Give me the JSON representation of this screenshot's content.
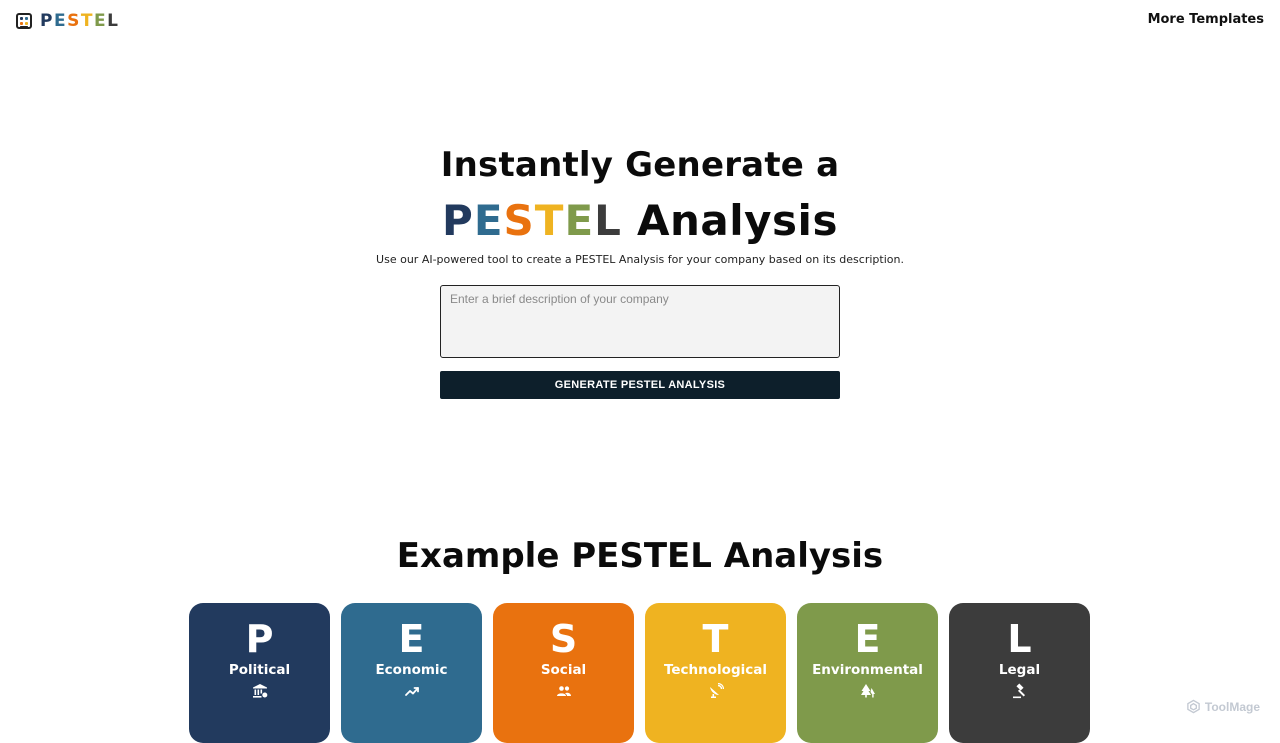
{
  "header": {
    "brand_letters": [
      {
        "char": "P",
        "color": "#223a5e"
      },
      {
        "char": "E",
        "color": "#2f6b8f"
      },
      {
        "char": "S",
        "color": "#e9720f"
      },
      {
        "char": "T",
        "color": "#efb321"
      },
      {
        "char": "E",
        "color": "#7f9a4b"
      },
      {
        "char": "L",
        "color": "#3c3c3c"
      }
    ],
    "more_templates_label": "More Templates"
  },
  "hero": {
    "line1": "Instantly Generate a",
    "line2_suffix": "Analysis",
    "subtitle": "Use our AI-powered tool to create a PESTEL Analysis for your company based on its description.",
    "input_placeholder": "Enter a brief description of your company",
    "input_value": "",
    "generate_label": "GENERATE PESTEL ANALYSIS"
  },
  "example": {
    "title": "Example PESTEL Analysis",
    "cards": [
      {
        "letter": "P",
        "name": "Political",
        "icon": "government-building-icon",
        "color": "#223a5e",
        "text": ""
      },
      {
        "letter": "E",
        "name": "Economic",
        "icon": "trending-up-icon",
        "color": "#2f6b8f",
        "text": ""
      },
      {
        "letter": "S",
        "name": "Social",
        "icon": "people-icon",
        "color": "#e9720f",
        "text": ""
      },
      {
        "letter": "T",
        "name": "Technological",
        "icon": "satellite-dish-icon",
        "color": "#efb321",
        "text": ""
      },
      {
        "letter": "E",
        "name": "Environmental",
        "icon": "forest-trees-icon",
        "color": "#7f9a4b",
        "text": ""
      },
      {
        "letter": "L",
        "name": "Legal",
        "icon": "gavel-icon",
        "color": "#3c3c3c",
        "text": ""
      }
    ]
  },
  "watermark": {
    "label": "ToolMage",
    "icon": "toolmage-logo-icon"
  }
}
